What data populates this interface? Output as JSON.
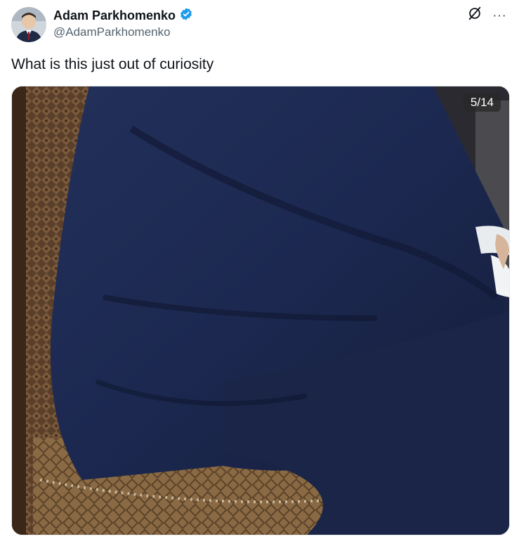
{
  "author": {
    "name": "Adam Parkhomenko",
    "handle": "@AdamParkhomenko",
    "verified": true,
    "verified_color": "#1d9bf0"
  },
  "tweet": {
    "text": "What is this just out of curiosity"
  },
  "media": {
    "counter": "5/14",
    "alt_icon": "photo"
  },
  "icons": {
    "grok": "grok-icon",
    "more": "more-icon",
    "more_glyph": "···"
  }
}
